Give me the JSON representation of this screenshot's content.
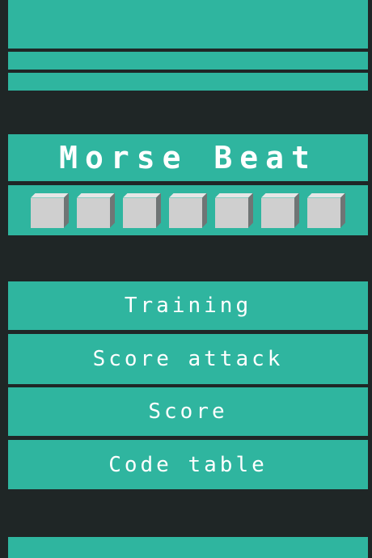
{
  "app": {
    "title": "Morse Beat",
    "colors": {
      "background": "#1f2626",
      "band": "#2fb59f",
      "text": "#ffffff",
      "cube": "#cfcfcf"
    }
  },
  "code_display": {
    "slots": [
      {
        "icon": "empty-cube-icon"
      },
      {
        "icon": "empty-cube-icon"
      },
      {
        "icon": "empty-cube-icon"
      },
      {
        "icon": "empty-cube-icon"
      },
      {
        "icon": "empty-cube-icon"
      },
      {
        "icon": "empty-cube-icon"
      },
      {
        "icon": "empty-cube-icon"
      }
    ]
  },
  "menu": {
    "items": [
      {
        "label": "Training"
      },
      {
        "label": "Score attack"
      },
      {
        "label": "Score"
      },
      {
        "label": "Code table"
      }
    ]
  }
}
